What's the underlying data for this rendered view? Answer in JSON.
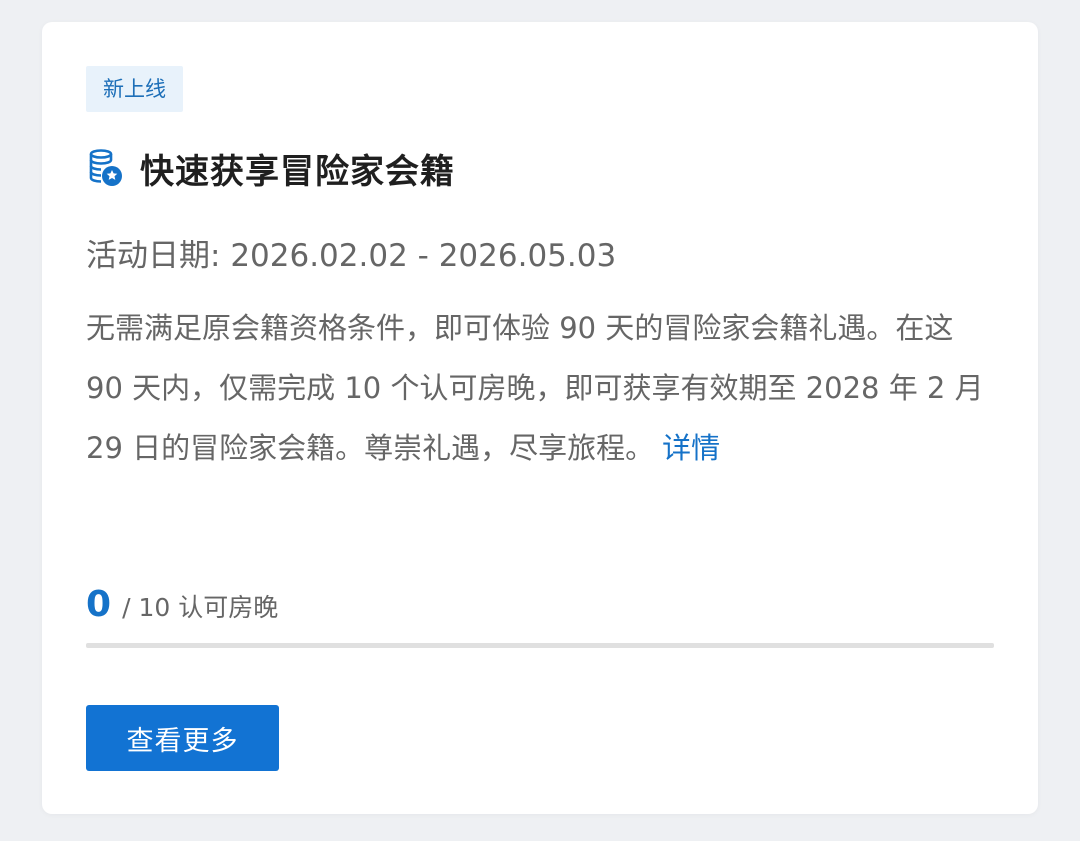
{
  "card": {
    "badge": "新上线",
    "title_icon": "coin-stack-icon",
    "title": "快速获享冒险家会籍",
    "date_label": "活动日期:",
    "date_range": "2026.02.02 - 2026.05.03",
    "description": "无需满足原会籍资格条件，即可体验 90 天的冒险家会籍礼遇。在这 90 天内，仅需完成 10 个认可房晚，即可获享有效期至 2028 年 2 月 29 日的冒险家会籍。尊崇礼遇，尽享旅程。",
    "details_link": "详情",
    "progress": {
      "current": "0",
      "total_text": "/ 10 认可房晚",
      "fraction": 0
    },
    "button_label": "查看更多"
  },
  "colors": {
    "accent": "#1572c8",
    "button": "#1273d3",
    "badge_bg": "#e8f2fb",
    "text_muted": "#666666",
    "background": "#eef0f3"
  }
}
